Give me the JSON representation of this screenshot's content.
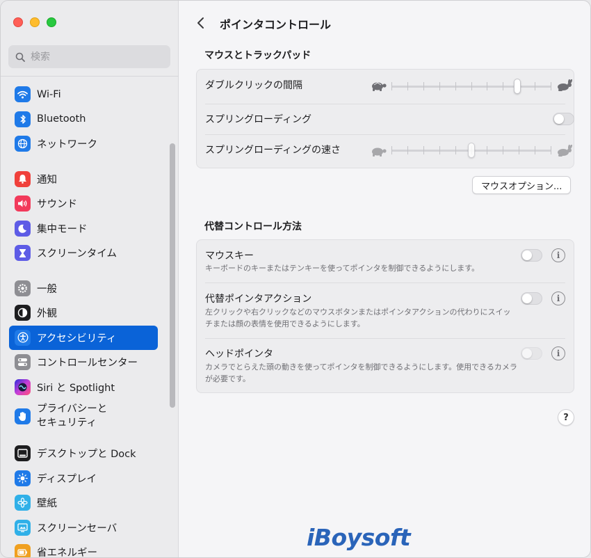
{
  "sidebar": {
    "search_placeholder": "検索",
    "items": [
      {
        "label": "Wi-Fi",
        "icon": "wifi-icon",
        "color": "#1f7ae8"
      },
      {
        "label": "Bluetooth",
        "icon": "bluetooth-icon",
        "color": "#1f7ae8"
      },
      {
        "label": "ネットワーク",
        "icon": "globe-icon",
        "color": "#1f7ae8"
      },
      {
        "label": "通知",
        "icon": "bell-icon",
        "color": "#f0403b"
      },
      {
        "label": "サウンド",
        "icon": "speaker-icon",
        "color": "#f23a5b"
      },
      {
        "label": "集中モード",
        "icon": "moon-icon",
        "color": "#5e5ce6"
      },
      {
        "label": "スクリーンタイム",
        "icon": "hourglass-icon",
        "color": "#5e5ce6"
      },
      {
        "label": "一般",
        "icon": "gear-icon",
        "color": "#8e8e93"
      },
      {
        "label": "外観",
        "icon": "appearance-icon",
        "color": "#1d1d1f"
      },
      {
        "label": "アクセシビリティ",
        "icon": "accessibility-icon",
        "color": "#1f7ae8"
      },
      {
        "label": "コントロールセンター",
        "icon": "control-center-icon",
        "color": "#8e8e93"
      },
      {
        "label": "Siri と Spotlight",
        "icon": "siri-icon",
        "color": "#6b3bd6"
      },
      {
        "label": "プライバシーと\nセキュリティ",
        "icon": "hand-icon",
        "color": "#1f7ae8"
      },
      {
        "label": "デスクトップと Dock",
        "icon": "dock-icon",
        "color": "#1d1d1f"
      },
      {
        "label": "ディスプレイ",
        "icon": "sun-icon",
        "color": "#1f7ae8"
      },
      {
        "label": "壁紙",
        "icon": "flower-icon",
        "color": "#30b0e8"
      },
      {
        "label": "スクリーンセーバ",
        "icon": "screensaver-icon",
        "color": "#30b0e8"
      },
      {
        "label": "省エネルギー",
        "icon": "battery-icon",
        "color": "#f0a020"
      }
    ],
    "selected_index": 9
  },
  "main": {
    "title": "ポインタコントロール",
    "section1_title": "マウスとトラックパッド",
    "double_click_label": "ダブルクリックの間隔",
    "double_click_value": 0.8,
    "spring_loading_label": "スプリングローディング",
    "spring_loading_on": false,
    "spring_speed_label": "スプリングローディングの速さ",
    "spring_speed_value": 0.5,
    "mouse_options_button": "マウスオプション...",
    "section2_title": "代替コントロール方法",
    "mouse_keys_label": "マウスキー",
    "mouse_keys_desc": "キーボードのキーまたはテンキーを使ってポインタを制御できるようにします。",
    "alt_pointer_label": "代替ポインタアクション",
    "alt_pointer_desc": "左クリックや右クリックなどのマウスボタンまたはポインタアクションの代わりにスイッチまたは顔の表情を使用できるようにします。",
    "head_pointer_label": "ヘッドポインタ",
    "head_pointer_desc": "カメラでとらえた頭の動きを使ってポインタを制御できるようにします。使用できるカメラが必要です。",
    "help_label": "?"
  },
  "watermark": "iBoysoft",
  "colors": {
    "accent": "#0a63d8"
  }
}
